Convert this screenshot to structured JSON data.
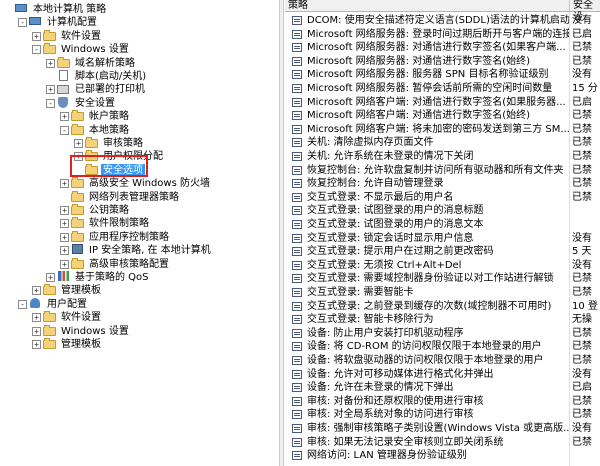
{
  "tree": [
    {
      "label": "本地计算机 策略",
      "depth": 0,
      "toggle": "",
      "icon": "computer"
    },
    {
      "label": "计算机配置",
      "depth": 1,
      "toggle": "-",
      "icon": "computer"
    },
    {
      "label": "软件设置",
      "depth": 2,
      "toggle": "+",
      "icon": "folder"
    },
    {
      "label": "Windows 设置",
      "depth": 2,
      "toggle": "-",
      "icon": "folder"
    },
    {
      "label": "域名解析策略",
      "depth": 3,
      "toggle": "+",
      "icon": "folder"
    },
    {
      "label": "脚本(启动/关机)",
      "depth": 3,
      "toggle": "",
      "icon": "script"
    },
    {
      "label": "已部署的打印机",
      "depth": 3,
      "toggle": "+",
      "icon": "printer"
    },
    {
      "label": "安全设置",
      "depth": 3,
      "toggle": "-",
      "icon": "shield"
    },
    {
      "label": "帐户策略",
      "depth": 4,
      "toggle": "+",
      "icon": "folder"
    },
    {
      "label": "本地策略",
      "depth": 4,
      "toggle": "-",
      "icon": "folder"
    },
    {
      "label": "审核策略",
      "depth": 5,
      "toggle": "+",
      "icon": "folder"
    },
    {
      "label": "用户权限分配",
      "depth": 5,
      "toggle": "+",
      "icon": "folder"
    },
    {
      "label": "安全选项",
      "depth": 5,
      "toggle": "",
      "icon": "folder",
      "selected": true
    },
    {
      "label": "高级安全 Windows 防火墙",
      "depth": 4,
      "toggle": "+",
      "icon": "firewall"
    },
    {
      "label": "网络列表管理器策略",
      "depth": 4,
      "toggle": "",
      "icon": "folder"
    },
    {
      "label": "公钥策略",
      "depth": 4,
      "toggle": "+",
      "icon": "folder"
    },
    {
      "label": "软件限制策略",
      "depth": 4,
      "toggle": "+",
      "icon": "folder"
    },
    {
      "label": "应用程序控制策略",
      "depth": 4,
      "toggle": "+",
      "icon": "folder"
    },
    {
      "label": "IP 安全策略, 在 本地计算机",
      "depth": 4,
      "toggle": "+",
      "icon": "ipsec"
    },
    {
      "label": "高级审核策略配置",
      "depth": 4,
      "toggle": "+",
      "icon": "folder"
    },
    {
      "label": "基于策略的 QoS",
      "depth": 3,
      "toggle": "+",
      "icon": "chart"
    },
    {
      "label": "管理模板",
      "depth": 2,
      "toggle": "+",
      "icon": "folder"
    },
    {
      "label": "用户配置",
      "depth": 1,
      "toggle": "-",
      "icon": "user"
    },
    {
      "label": "软件设置",
      "depth": 2,
      "toggle": "+",
      "icon": "folder"
    },
    {
      "label": "Windows 设置",
      "depth": 2,
      "toggle": "+",
      "icon": "folder"
    },
    {
      "label": "管理模板",
      "depth": 2,
      "toggle": "+",
      "icon": "folder"
    }
  ],
  "columns": {
    "policy": "策略",
    "setting": "安全设"
  },
  "policies": [
    {
      "name": "DCOM: 使用安全描述符定义语言(SDDL)语法的计算机启动限制",
      "value": "没有"
    },
    {
      "name": "Microsoft 网络服务器: 登录时间过期后断开与客户端的连接",
      "value": "已启"
    },
    {
      "name": "Microsoft 网络服务器: 对通信进行数字签名(如果客户端...",
      "value": "已禁"
    },
    {
      "name": "Microsoft 网络服务器: 对通信进行数字签名(始终)",
      "value": "已禁"
    },
    {
      "name": "Microsoft 网络服务器: 服务器 SPN 目标名称验证级别",
      "value": "没有"
    },
    {
      "name": "Microsoft 网络服务器: 暂停会话前所需的空闲时间数量",
      "value": "15 分"
    },
    {
      "name": "Microsoft 网络客户端: 对通信进行数字签名(如果服务器...",
      "value": "已启"
    },
    {
      "name": "Microsoft 网络客户端: 对通信进行数字签名(始终)",
      "value": "已禁"
    },
    {
      "name": "Microsoft 网络客户端: 将未加密的密码发送到第三方 SM...",
      "value": "已禁"
    },
    {
      "name": "关机: 清除虚拟内存页面文件",
      "value": "已禁"
    },
    {
      "name": "关机: 允许系统在未登录的情况下关闭",
      "value": "已禁"
    },
    {
      "name": "恢复控制台: 允许软盘复制并访问所有驱动器和所有文件夹",
      "value": "已禁"
    },
    {
      "name": "恢复控制台: 允许自动管理登录",
      "value": "已禁"
    },
    {
      "name": "交互式登录: 不显示最后的用户名",
      "value": "已禁"
    },
    {
      "name": "交互式登录: 试图登录的用户的消息标题",
      "value": ""
    },
    {
      "name": "交互式登录: 试图登录的用户的消息文本",
      "value": ""
    },
    {
      "name": "交互式登录: 锁定会话时显示用户信息",
      "value": "没有"
    },
    {
      "name": "交互式登录: 提示用户在过期之前更改密码",
      "value": "5 天"
    },
    {
      "name": "交互式登录: 无须按 Ctrl+Alt+Del",
      "value": "没有"
    },
    {
      "name": "交互式登录: 需要域控制器身份验证以对工作站进行解锁",
      "value": "已禁"
    },
    {
      "name": "交互式登录: 需要智能卡",
      "value": "已禁"
    },
    {
      "name": "交互式登录: 之前登录到缓存的次数(域控制器不可用时)",
      "value": "10 登"
    },
    {
      "name": "交互式登录: 智能卡移除行为",
      "value": "无操"
    },
    {
      "name": "设备: 防止用户安装打印机驱动程序",
      "value": "已禁"
    },
    {
      "name": "设备: 将 CD-ROM 的访问权限仅限于本地登录的用户",
      "value": "已禁"
    },
    {
      "name": "设备: 将软盘驱动器的访问权限仅限于本地登录的用户",
      "value": "已禁"
    },
    {
      "name": "设备: 允许对可移动媒体进行格式化并弹出",
      "value": "没有"
    },
    {
      "name": "设备: 允许在未登录的情况下弹出",
      "value": "已启"
    },
    {
      "name": "审核: 对备份和还原权限的使用进行审核",
      "value": "已禁"
    },
    {
      "name": "审核: 对全局系统对象的访问进行审核",
      "value": "已禁"
    },
    {
      "name": "审核: 强制审核策略子类别设置(Windows Vista 或更高版...",
      "value": "没有"
    },
    {
      "name": "审核: 如果无法记录安全审核则立即关闭系统",
      "value": "已禁"
    },
    {
      "name": "网络访问: LAN 管理器身份验证级别",
      "value": ""
    }
  ]
}
